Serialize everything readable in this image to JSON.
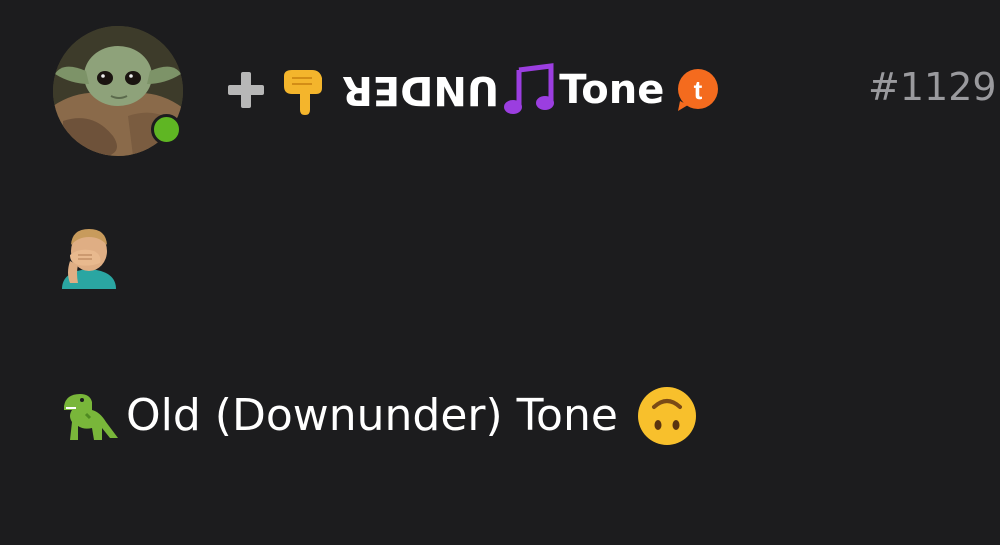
{
  "user": {
    "avatar_icon": "baby-yoda-avatar",
    "online_status": "online",
    "status_color": "#5fb623",
    "display_name_prefix_icons": [
      "heavy-plus-icon",
      "backhand-index-pointing-down-icon"
    ],
    "display_name_flipped": "UNDER",
    "display_name_note_icon": "musical-note-icon",
    "display_name_suffix": "Tone",
    "badge_icon": "tumblr-speech-badge-icon",
    "badge_color": "#f46b1e",
    "id": "#1129"
  },
  "post": {
    "reaction_icon": "man-facepalming-icon",
    "line_prefix_icon": "t-rex-icon",
    "line_text": "Old (Downunder) Tone",
    "line_suffix_icon": "upside-down-face-icon"
  }
}
